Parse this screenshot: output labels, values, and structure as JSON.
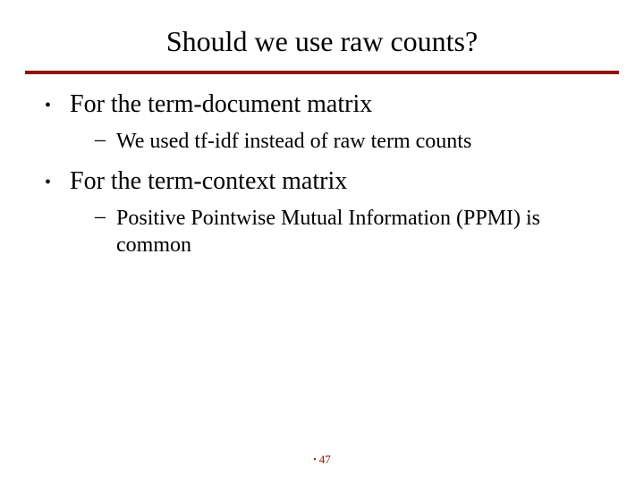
{
  "title": "Should we use raw counts?",
  "bullets": {
    "b1": {
      "text": "For the term-document matrix"
    },
    "b1s1": {
      "text": "We used tf-idf instead of raw term counts"
    },
    "b2": {
      "text": "For the term-context matrix"
    },
    "b2s1": {
      "text": "Positive Pointwise Mutual Information (PPMI) is common"
    }
  },
  "page_number": "47"
}
